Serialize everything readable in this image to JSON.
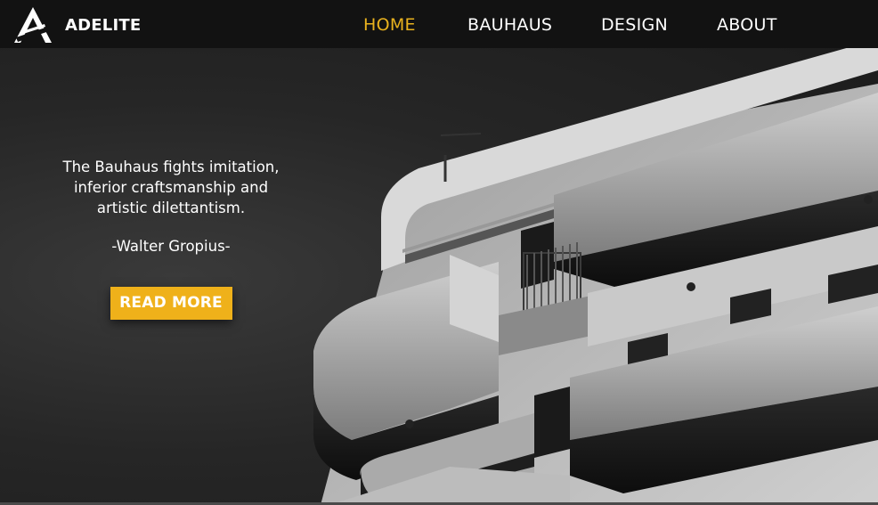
{
  "brand": {
    "name": "ADELITE",
    "logo_icon": "adelite-a-logo-icon"
  },
  "nav": {
    "items": [
      {
        "label": "HOME",
        "active": true
      },
      {
        "label": "BAUHAUS",
        "active": false
      },
      {
        "label": "DESIGN",
        "active": false
      },
      {
        "label": "ABOUT",
        "active": false
      }
    ]
  },
  "hero": {
    "quote_lines": [
      "The Bauhaus fights imitation,",
      "inferior craftsmanship and",
      "artistic dilettantism."
    ],
    "author": "-Walter Gropius-",
    "cta_label": "READ MORE",
    "image": "bauhaus-building-photo"
  },
  "colors": {
    "accent": "#efb11a",
    "nav_active": "#e9b21e",
    "navbar_bg": "#121212",
    "text": "#ffffff"
  }
}
